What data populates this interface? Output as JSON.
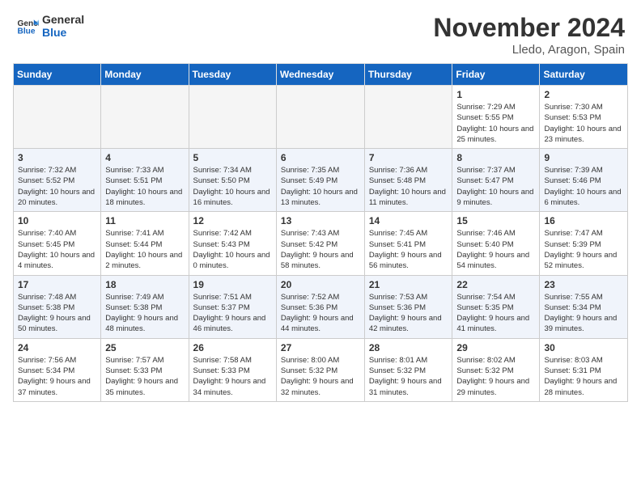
{
  "header": {
    "logo": {
      "general": "General",
      "blue": "Blue"
    },
    "title": "November 2024",
    "location": "Lledo, Aragon, Spain"
  },
  "calendar": {
    "days_of_week": [
      "Sunday",
      "Monday",
      "Tuesday",
      "Wednesday",
      "Thursday",
      "Friday",
      "Saturday"
    ],
    "weeks": [
      [
        {
          "day": null,
          "empty": true
        },
        {
          "day": null,
          "empty": true
        },
        {
          "day": null,
          "empty": true
        },
        {
          "day": null,
          "empty": true
        },
        {
          "day": null,
          "empty": true
        },
        {
          "day": 1,
          "sunrise": "7:29 AM",
          "sunset": "5:55 PM",
          "daylight": "10 hours and 25 minutes."
        },
        {
          "day": 2,
          "sunrise": "7:30 AM",
          "sunset": "5:53 PM",
          "daylight": "10 hours and 23 minutes."
        }
      ],
      [
        {
          "day": 3,
          "sunrise": "7:32 AM",
          "sunset": "5:52 PM",
          "daylight": "10 hours and 20 minutes."
        },
        {
          "day": 4,
          "sunrise": "7:33 AM",
          "sunset": "5:51 PM",
          "daylight": "10 hours and 18 minutes."
        },
        {
          "day": 5,
          "sunrise": "7:34 AM",
          "sunset": "5:50 PM",
          "daylight": "10 hours and 16 minutes."
        },
        {
          "day": 6,
          "sunrise": "7:35 AM",
          "sunset": "5:49 PM",
          "daylight": "10 hours and 13 minutes."
        },
        {
          "day": 7,
          "sunrise": "7:36 AM",
          "sunset": "5:48 PM",
          "daylight": "10 hours and 11 minutes."
        },
        {
          "day": 8,
          "sunrise": "7:37 AM",
          "sunset": "5:47 PM",
          "daylight": "10 hours and 9 minutes."
        },
        {
          "day": 9,
          "sunrise": "7:39 AM",
          "sunset": "5:46 PM",
          "daylight": "10 hours and 6 minutes."
        }
      ],
      [
        {
          "day": 10,
          "sunrise": "7:40 AM",
          "sunset": "5:45 PM",
          "daylight": "10 hours and 4 minutes."
        },
        {
          "day": 11,
          "sunrise": "7:41 AM",
          "sunset": "5:44 PM",
          "daylight": "10 hours and 2 minutes."
        },
        {
          "day": 12,
          "sunrise": "7:42 AM",
          "sunset": "5:43 PM",
          "daylight": "10 hours and 0 minutes."
        },
        {
          "day": 13,
          "sunrise": "7:43 AM",
          "sunset": "5:42 PM",
          "daylight": "9 hours and 58 minutes."
        },
        {
          "day": 14,
          "sunrise": "7:45 AM",
          "sunset": "5:41 PM",
          "daylight": "9 hours and 56 minutes."
        },
        {
          "day": 15,
          "sunrise": "7:46 AM",
          "sunset": "5:40 PM",
          "daylight": "9 hours and 54 minutes."
        },
        {
          "day": 16,
          "sunrise": "7:47 AM",
          "sunset": "5:39 PM",
          "daylight": "9 hours and 52 minutes."
        }
      ],
      [
        {
          "day": 17,
          "sunrise": "7:48 AM",
          "sunset": "5:38 PM",
          "daylight": "9 hours and 50 minutes."
        },
        {
          "day": 18,
          "sunrise": "7:49 AM",
          "sunset": "5:38 PM",
          "daylight": "9 hours and 48 minutes."
        },
        {
          "day": 19,
          "sunrise": "7:51 AM",
          "sunset": "5:37 PM",
          "daylight": "9 hours and 46 minutes."
        },
        {
          "day": 20,
          "sunrise": "7:52 AM",
          "sunset": "5:36 PM",
          "daylight": "9 hours and 44 minutes."
        },
        {
          "day": 21,
          "sunrise": "7:53 AM",
          "sunset": "5:36 PM",
          "daylight": "9 hours and 42 minutes."
        },
        {
          "day": 22,
          "sunrise": "7:54 AM",
          "sunset": "5:35 PM",
          "daylight": "9 hours and 41 minutes."
        },
        {
          "day": 23,
          "sunrise": "7:55 AM",
          "sunset": "5:34 PM",
          "daylight": "9 hours and 39 minutes."
        }
      ],
      [
        {
          "day": 24,
          "sunrise": "7:56 AM",
          "sunset": "5:34 PM",
          "daylight": "9 hours and 37 minutes."
        },
        {
          "day": 25,
          "sunrise": "7:57 AM",
          "sunset": "5:33 PM",
          "daylight": "9 hours and 35 minutes."
        },
        {
          "day": 26,
          "sunrise": "7:58 AM",
          "sunset": "5:33 PM",
          "daylight": "9 hours and 34 minutes."
        },
        {
          "day": 27,
          "sunrise": "8:00 AM",
          "sunset": "5:32 PM",
          "daylight": "9 hours and 32 minutes."
        },
        {
          "day": 28,
          "sunrise": "8:01 AM",
          "sunset": "5:32 PM",
          "daylight": "9 hours and 31 minutes."
        },
        {
          "day": 29,
          "sunrise": "8:02 AM",
          "sunset": "5:32 PM",
          "daylight": "9 hours and 29 minutes."
        },
        {
          "day": 30,
          "sunrise": "8:03 AM",
          "sunset": "5:31 PM",
          "daylight": "9 hours and 28 minutes."
        }
      ]
    ]
  }
}
